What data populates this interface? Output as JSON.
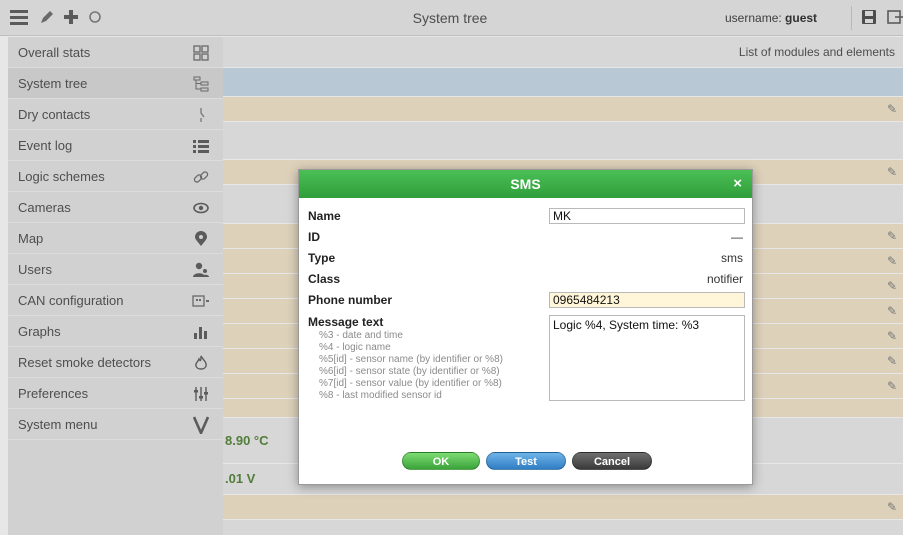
{
  "toolbar": {
    "title": "System tree",
    "username_label": "username:",
    "username": "guest"
  },
  "sidebar": {
    "items": [
      {
        "label": "Overall stats",
        "icon": "grid-icon"
      },
      {
        "label": "System tree",
        "icon": "tree-icon"
      },
      {
        "label": "Dry contacts",
        "icon": "switch-icon"
      },
      {
        "label": "Event log",
        "icon": "list-icon"
      },
      {
        "label": "Logic schemes",
        "icon": "link-icon"
      },
      {
        "label": "Cameras",
        "icon": "eye-icon"
      },
      {
        "label": "Map",
        "icon": "map-pin-icon"
      },
      {
        "label": "Users",
        "icon": "users-icon"
      },
      {
        "label": "CAN configuration",
        "icon": "can-icon"
      },
      {
        "label": "Graphs",
        "icon": "bar-chart-icon"
      },
      {
        "label": "Reset smoke detectors",
        "icon": "flame-icon"
      },
      {
        "label": "Preferences",
        "icon": "sliders-icon"
      },
      {
        "label": "System menu",
        "icon": "v-icon"
      }
    ]
  },
  "main": {
    "list_title": "List of modules and elements",
    "temperature": "8.90 °C",
    "voltage": ".01 V"
  },
  "dialog": {
    "title": "SMS",
    "close": "×",
    "name_label": "Name",
    "name_value": "MK",
    "id_label": "ID",
    "id_value": "—",
    "type_label": "Type",
    "type_value": "sms",
    "class_label": "Class",
    "class_value": "notifier",
    "phone_label": "Phone number",
    "phone_value": "0965484213",
    "message_label": "Message text",
    "message_value": "Logic %4, System time: %3",
    "hints": [
      "%3 - date and time",
      "%4 - logic name",
      "%5[id] - sensor name (by identifier or %8)",
      "%6[id] - sensor state (by identifier or %8)",
      "%7[id] - sensor value (by identifier or %8)",
      "%8 - last modified sensor id"
    ],
    "ok_label": "OK",
    "test_label": "Test",
    "cancel_label": "Cancel"
  },
  "colors": {
    "header_green": "#3aa844",
    "row_tan": "#f3e4c9",
    "row_blue": "#c6dbe9",
    "row_grey": "#ececec"
  }
}
